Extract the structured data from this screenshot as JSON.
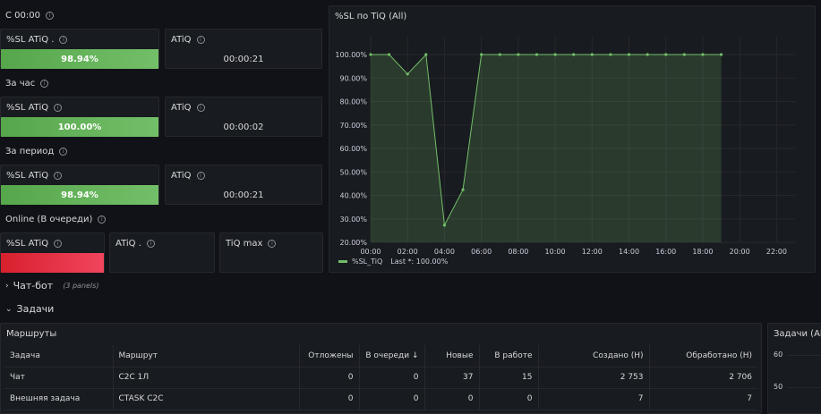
{
  "sections": {
    "since_midnight": "С 00:00",
    "last_hour": "За час",
    "period": "За период",
    "online": "Online (В очереди)"
  },
  "stats": {
    "midnight": {
      "sl_title": "%SL ATiQ .",
      "sl_value": "98.94%",
      "sl_fraction": 0.9894,
      "atiq_title": "ATiQ",
      "atiq_value": "00:00:21"
    },
    "hour": {
      "sl_title": "%SL ATiQ",
      "sl_value": "100.00%",
      "sl_fraction": 1.0,
      "atiq_title": "ATiQ",
      "atiq_value": "00:00:02"
    },
    "period": {
      "sl_title": "%SL ATiQ",
      "sl_value": "98.94%",
      "sl_fraction": 0.9894,
      "atiq_title": "ATiQ",
      "atiq_value": "00:00:21"
    },
    "online": {
      "sl_title": "%SL ATiQ",
      "atiq_title": "ATiQ .",
      "tiqmax_title": "TiQ max"
    }
  },
  "chart": {
    "title": "%SL по TiQ (All)",
    "legend_label": "%SL_TiQ",
    "legend_last": "Last *: 100.00%"
  },
  "chart_data": {
    "type": "area",
    "title": "%SL по TiQ (All)",
    "xlabel": "",
    "ylabel": "",
    "x_ticks": [
      "00:00",
      "02:00",
      "04:00",
      "06:00",
      "08:00",
      "10:00",
      "12:00",
      "14:00",
      "16:00",
      "18:00",
      "20:00",
      "22:00"
    ],
    "y_ticks": [
      "20.00%",
      "30.00%",
      "40.00%",
      "50.00%",
      "60.00%",
      "70.00%",
      "80.00%",
      "90.00%",
      "100.00%"
    ],
    "xlim": [
      0,
      23
    ],
    "ylim": [
      20,
      100
    ],
    "grid": true,
    "legend_position": "bottom-left",
    "series": [
      {
        "name": "%SL_TiQ",
        "color": "#73bf69",
        "x": [
          0,
          1,
          2,
          3,
          4,
          5,
          6,
          7,
          8,
          9,
          10,
          11,
          12,
          13,
          14,
          15,
          16,
          17,
          18,
          19
        ],
        "y": [
          100,
          100,
          91.7,
          100,
          27.3,
          42.4,
          100,
          100,
          100,
          100,
          100,
          100,
          100,
          100,
          100,
          100,
          100,
          100,
          100,
          100
        ]
      }
    ]
  },
  "rows": {
    "chatbot": {
      "label": "Чат-бот",
      "count": "(3 panels)"
    },
    "tasks": {
      "label": "Задачи"
    }
  },
  "routes": {
    "title": "Маршруты",
    "columns": [
      "Задача",
      "Маршрут",
      "Отложены",
      "В очереди ↓",
      "Новые",
      "В работе",
      "Создано (Н)",
      "Обработано (Н)"
    ],
    "rows": [
      [
        "Чат",
        "C2C 1Л",
        "0",
        "0",
        "37",
        "15",
        "2 753",
        "2 706"
      ],
      [
        "Внешняя задача",
        "CTASK C2C",
        "0",
        "0",
        "0",
        "0",
        "7",
        "7"
      ]
    ]
  },
  "tasks_panel": {
    "title": "Задачи (All)",
    "ticks": [
      "60",
      "50"
    ]
  }
}
